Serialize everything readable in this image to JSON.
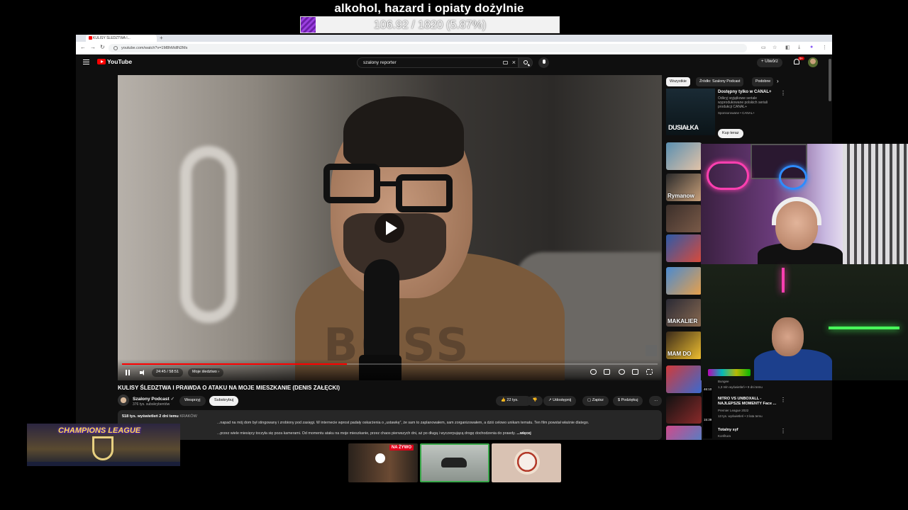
{
  "overlay": {
    "goal_title": "alkohol, hazard i opiaty dożylnie",
    "goal_text": "106.92 / 1820 (5.87%)",
    "goal_progress": 0.0587
  },
  "browser": {
    "tab_title": "KULISY ŚLEDZTWA I...",
    "url": "youtube.com/watch?v=1M8hMdlN2Ms"
  },
  "youtube": {
    "logo": "YouTube",
    "search_value": "szalony reporter",
    "create_label": "Utwórz",
    "notif_count": "9+"
  },
  "player": {
    "time": "24:45 / 58:51",
    "chapter": "Moje śledztwo",
    "progress": 0.42,
    "shirt_text": "BOSS"
  },
  "video": {
    "title": "KULISY ŚLEDZTWA I PRAWDA O ATAKU NA MOJE MIESZKANIE (DENIS ZAŁĘCKI)",
    "channel": "Szalony Podcast",
    "subscribers": "376 tys. subskrybentów",
    "support_label": "Wesprzyj",
    "subscribe_label": "Subskrybuj",
    "likes": "22 tys.",
    "share_label": "Udostępnij",
    "save_label": "Zapisz",
    "thanks_label": "Podziękuj",
    "views_date": "518 tys. wyświetleń  2 dni temu",
    "location_tag": "KRAKÓW",
    "desc_line1": "...napad na mój dom był stingowany i zrobiony pod zasięgi. W internecie wprost padały oskarżenia o „ustawkę”, że sam to zaplanowałem, sam zorganizowałem, a dziś celowo unikam tematu. Ten film powstał właśnie dlatego.",
    "desc_line2": "...przez wiele miesięcy toczyła się poza kamerami. Od momentu ataku na moje mieszkanie, przez chaos pierwszych dni, aż po długą i wyczerpującą drogę dochodzenia do prawdy.",
    "more_label": "...więcej"
  },
  "sidebar": {
    "chips": [
      "Wszystkie",
      "Źródło: Szalony Podcast",
      "Podobne"
    ],
    "ad": {
      "thumb_text": "DUSIAŁKA",
      "title": "Dostępny tylko w CANAL+",
      "desc": "Odkryj wyjątkowe seriale wyprodukowane polskich seriali produkcji CANAL+",
      "sponsor": "Sponsorowane • CANAL+",
      "cta": "Kup teraz"
    },
    "thumbs": [
      {
        "label": "",
        "color_a": "#5a8fb0",
        "color_b": "#e3c3a8"
      },
      {
        "label": "Rymanow",
        "color_a": "#2a2a2a",
        "color_b": "#c9a07a"
      },
      {
        "label": "",
        "color_a": "#3b2f2a",
        "color_b": "#7a5a48"
      },
      {
        "label": "",
        "color_a": "#2d5aa8",
        "color_b": "#d94a3a"
      },
      {
        "label": "",
        "color_a": "#4a8ad0",
        "color_b": "#e8a04a"
      },
      {
        "label": "MAKALIER",
        "color_a": "#2a2a35",
        "color_b": "#8a6a50"
      },
      {
        "label": "MAM DO",
        "color_a": "#3a2a1a",
        "color_b": "#f0c030"
      },
      {
        "label": "",
        "color_a": "#d03a3a",
        "color_b": "#3a6ad0"
      },
      {
        "label": "",
        "color_a": "#111111",
        "color_b": "#8a2a2a"
      },
      {
        "label": "",
        "color_a": "#d04a8a",
        "color_b": "#3a8ad0"
      }
    ],
    "item_bungee": {
      "channel": "Bungee",
      "meta": "1,3 mln wyświetleń • 9 dni temu",
      "duration": "46:10"
    },
    "item_nitro": {
      "title": "NITRO VS UNBOXALL - NAJLEPSZE MOMENTY Face ...",
      "channel": "Premier League 2022",
      "meta": "13 tys. wyświetleń • 3 lata temu",
      "duration": "15:39"
    },
    "item_totalny": {
      "title": "Totalny syf",
      "channel": "Konfitura"
    }
  },
  "cards": {
    "live_label": "NA ŻYWO",
    "cl_text": "CHAMPIONS LEAGUE"
  }
}
